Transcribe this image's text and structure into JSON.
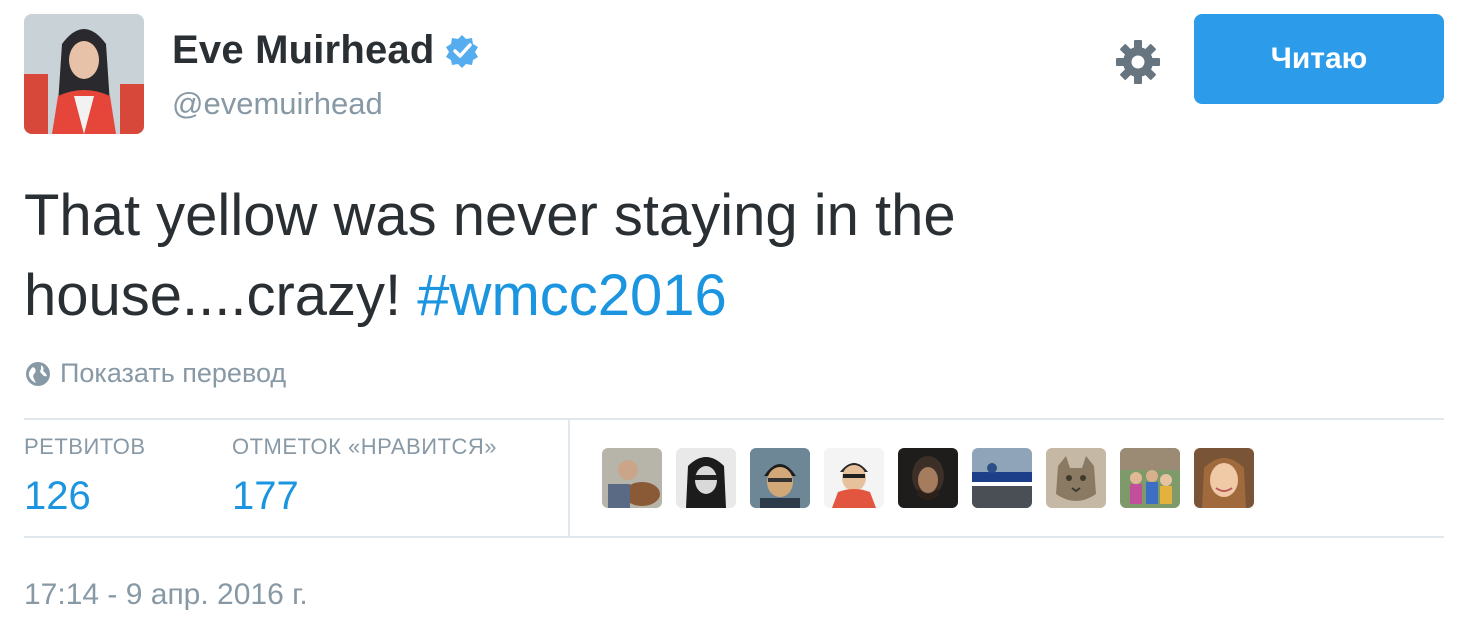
{
  "profile": {
    "name": "Eve Muirhead",
    "handle": "@evemuirhead",
    "verified_icon": "verified-badge-icon",
    "avatar_icon": "avatar"
  },
  "actions": {
    "settings_icon": "gear-icon",
    "follow_label": "Читаю"
  },
  "tweet": {
    "text": "That yellow was never staying in the house....crazy! ",
    "hashtag": "#wmcc2016",
    "translate_label": "Показать перевод",
    "translate_icon": "globe-icon",
    "timestamp": "17:14 - 9 апр. 2016 г."
  },
  "stats": {
    "retweets_label": "РЕТВИТОВ",
    "retweets_value": "126",
    "likes_label": "ОТМЕТОК «НРАВИТСЯ»",
    "likes_value": "177"
  },
  "colors": {
    "accent": "#1b95e0",
    "button": "#2b9bea",
    "muted": "#8899a6",
    "text": "#292f33",
    "divider": "#e1e8ed"
  }
}
